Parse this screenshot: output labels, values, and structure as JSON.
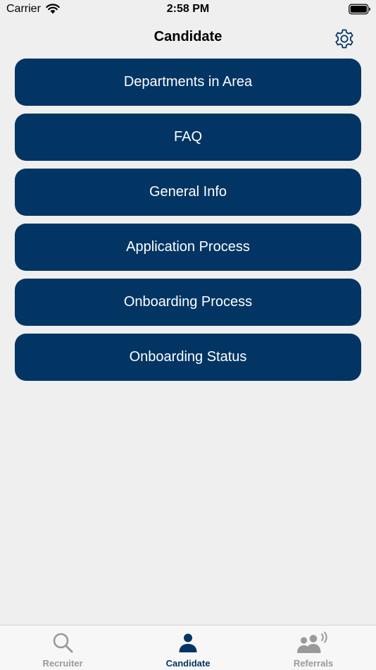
{
  "status_bar": {
    "carrier": "Carrier",
    "time": "2:58 PM"
  },
  "header": {
    "title": "Candidate",
    "settings_icon": "gear-icon"
  },
  "menu": {
    "items": [
      {
        "label": "Departments in Area"
      },
      {
        "label": "FAQ"
      },
      {
        "label": "General Info"
      },
      {
        "label": "Application Process"
      },
      {
        "label": "Onboarding Process"
      },
      {
        "label": "Onboarding Status"
      }
    ]
  },
  "tab_bar": {
    "tabs": [
      {
        "label": "Recruiter",
        "icon": "search-icon",
        "selected": false
      },
      {
        "label": "Candidate",
        "icon": "person-icon",
        "selected": true
      },
      {
        "label": "Referrals",
        "icon": "people-broadcast-icon",
        "selected": false
      }
    ]
  },
  "colors": {
    "background": "#efefef",
    "button": "#023564",
    "button_text": "#ffffff",
    "tab_selected": "#023564",
    "tab_unselected": "#9a9a9a"
  }
}
